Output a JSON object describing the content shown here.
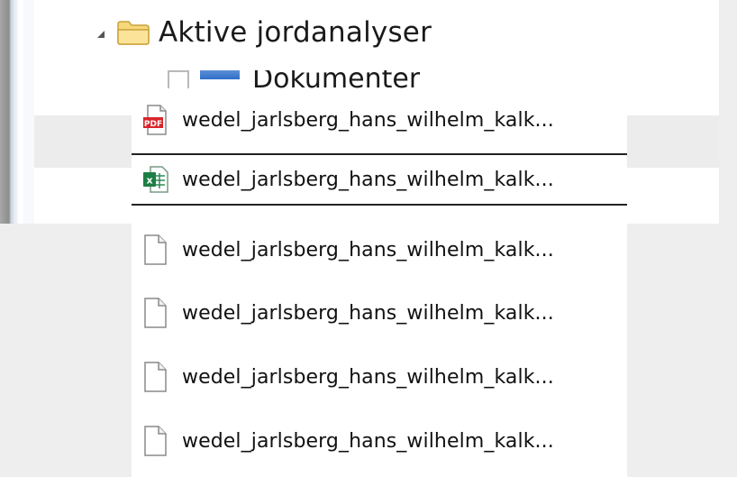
{
  "tree": {
    "folder_label": "Aktive jordanalyser",
    "partial_item_label": "Dokumenter"
  },
  "drag_list": {
    "items": [
      {
        "label": "wedel_jarlsberg_hans_wilhelm_kalk...",
        "icon": "pdf-file-icon",
        "selected": false
      },
      {
        "label": "wedel_jarlsberg_hans_wilhelm_kalk...",
        "icon": "excel-file-icon",
        "selected": true
      },
      {
        "label": "wedel_jarlsberg_hans_wilhelm_kalk...",
        "icon": "blank-file-icon",
        "selected": false
      },
      {
        "label": "wedel_jarlsberg_hans_wilhelm_kalk...",
        "icon": "blank-file-icon",
        "selected": false
      },
      {
        "label": "wedel_jarlsberg_hans_wilhelm_kalk...",
        "icon": "blank-file-icon",
        "selected": false
      },
      {
        "label": "wedel_jarlsberg_hans_wilhelm_kalk...",
        "icon": "blank-file-icon",
        "selected": false
      }
    ]
  },
  "colors": {
    "folder": "#f2c94c",
    "pdf_red": "#d9252a",
    "excel_green": "#1e7e45"
  }
}
